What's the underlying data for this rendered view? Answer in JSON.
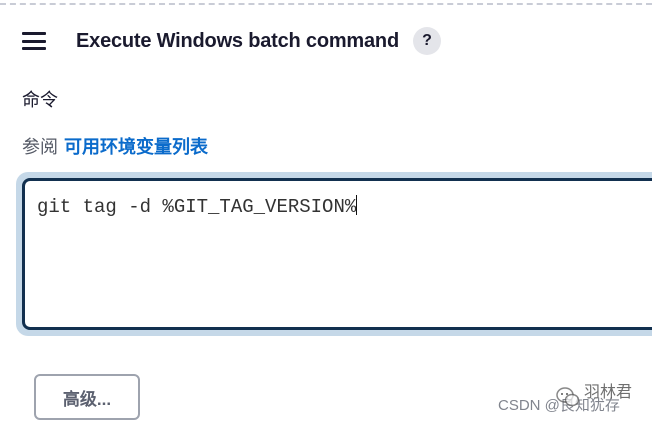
{
  "header": {
    "title": "Execute Windows batch command",
    "help_label": "?",
    "drag_handle_icon": "hamburger-drag-icon"
  },
  "command": {
    "label": "命令",
    "see_also_prefix": "参阅",
    "see_also_link": "可用环境变量列表",
    "value": "git tag -d %GIT_TAG_VERSION%"
  },
  "advanced": {
    "label": "高级..."
  },
  "watermark": {
    "csdn": "CSDN @良知犹存",
    "name": "羽林君",
    "icon": "wechat-icon"
  },
  "colors": {
    "link": "#0b6bcb",
    "editor_border": "#12304f",
    "focus_ring": "#c5d8e8"
  }
}
